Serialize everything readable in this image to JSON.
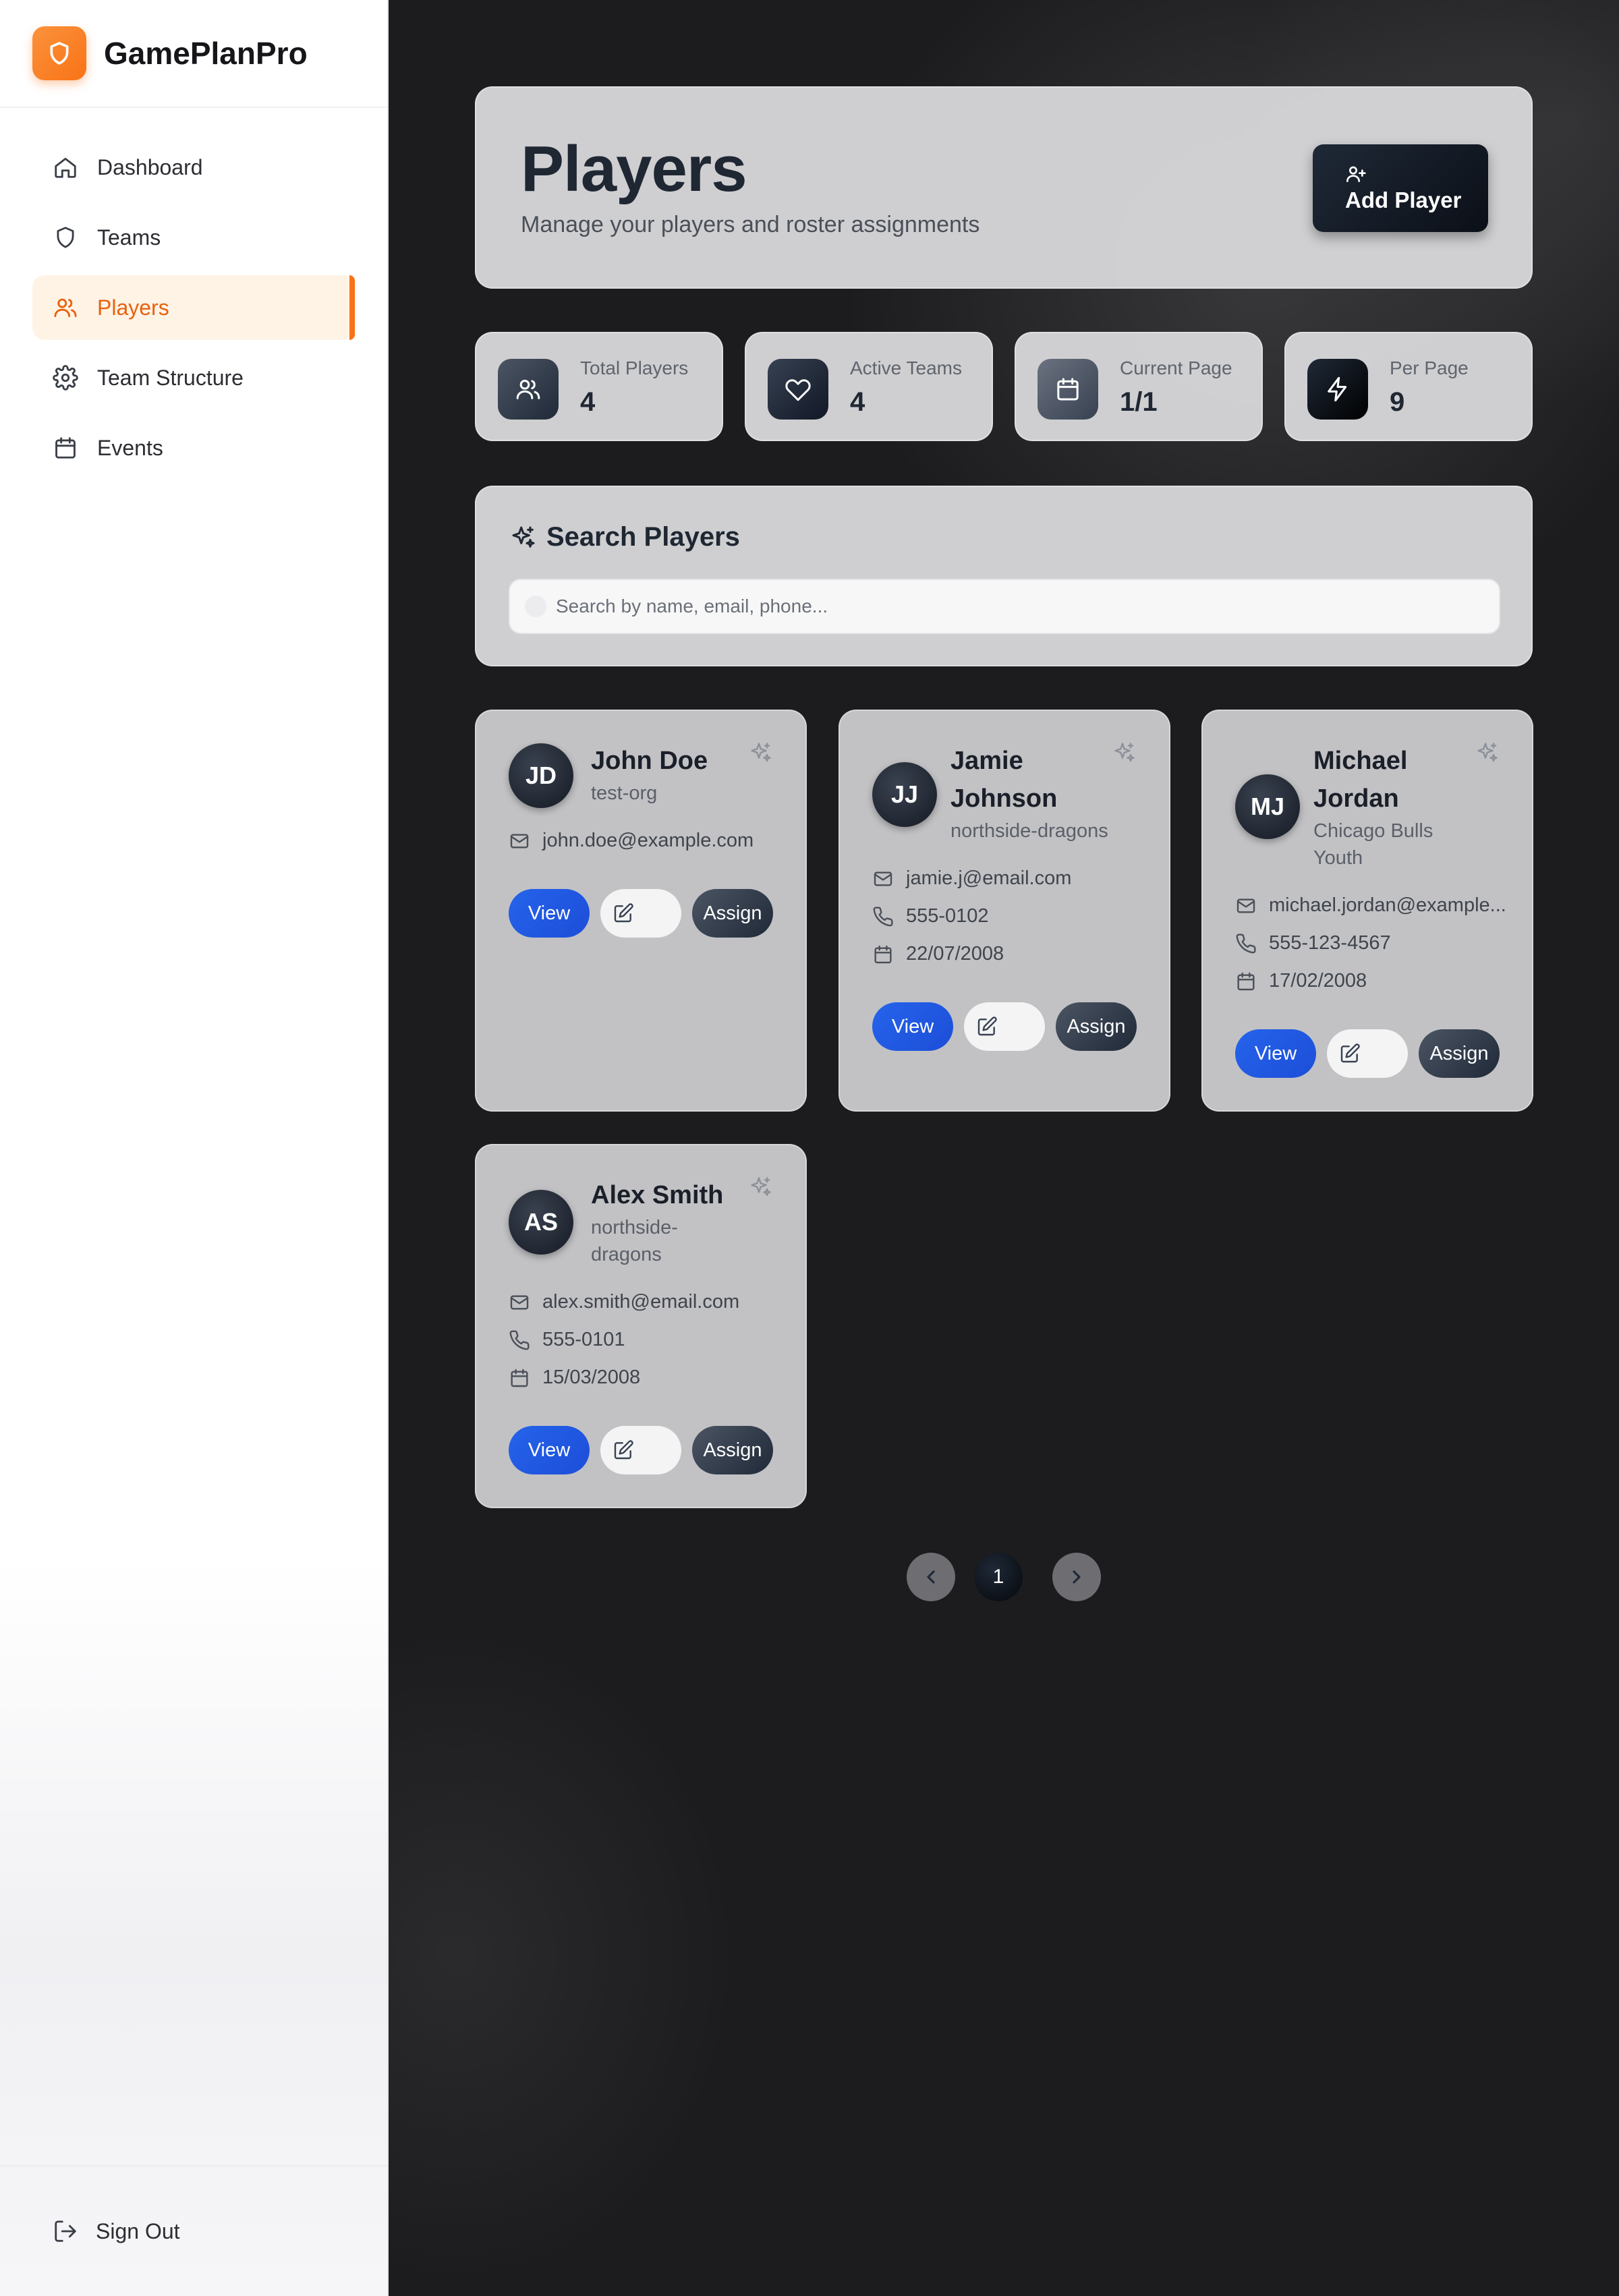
{
  "app": {
    "name": "GamePlanPro"
  },
  "sidebar": {
    "items": [
      {
        "label": "Dashboard",
        "icon": "home-icon"
      },
      {
        "label": "Teams",
        "icon": "shield-icon"
      },
      {
        "label": "Players",
        "icon": "users-icon",
        "active": true
      },
      {
        "label": "Team Structure",
        "icon": "gear-icon"
      },
      {
        "label": "Events",
        "icon": "calendar-icon"
      }
    ],
    "sign_out": "Sign Out"
  },
  "header": {
    "title": "Players",
    "subtitle": "Manage your players and roster assignments",
    "add_button": "Add Player"
  },
  "stats": [
    {
      "label": "Total Players",
      "value": "4",
      "icon": "users-icon"
    },
    {
      "label": "Active Teams",
      "value": "4",
      "icon": "heart-icon"
    },
    {
      "label": "Current Page",
      "value": "1/1",
      "icon": "calendar-icon"
    },
    {
      "label": "Per Page",
      "value": "9",
      "icon": "lightning-icon"
    }
  ],
  "search": {
    "title": "Search Players",
    "placeholder": "Search by name, email, phone...",
    "value": ""
  },
  "players": [
    {
      "initials": "JD",
      "name_lines": [
        "John Doe"
      ],
      "team_lines": [
        "test-org"
      ],
      "email": "john.doe@example.com"
    },
    {
      "initials": "JJ",
      "name_lines": [
        "Jamie",
        "Johnson"
      ],
      "team_lines": [
        "northside-dragons"
      ],
      "email": "jamie.j@email.com",
      "phone": "555-0102",
      "dob": "22/07/2008"
    },
    {
      "initials": "MJ",
      "name_lines": [
        "Michael",
        "Jordan"
      ],
      "team_lines": [
        "Chicago Bulls",
        "Youth"
      ],
      "email": "michael.jordan@example...",
      "phone": "555-123-4567",
      "dob": "17/02/2008"
    },
    {
      "initials": "AS",
      "name_lines": [
        "Alex Smith"
      ],
      "team_lines": [
        "northside-",
        "dragons"
      ],
      "email": "alex.smith@email.com",
      "phone": "555-0101",
      "dob": "15/03/2008"
    }
  ],
  "card_actions": {
    "view": "View",
    "assign": "Assign"
  },
  "pagination": {
    "current": "1"
  },
  "colors": {
    "accent": "#f97316",
    "primary_button": "#2563eb",
    "dark_button": "#1f2937",
    "background": "#1c1c1e"
  }
}
